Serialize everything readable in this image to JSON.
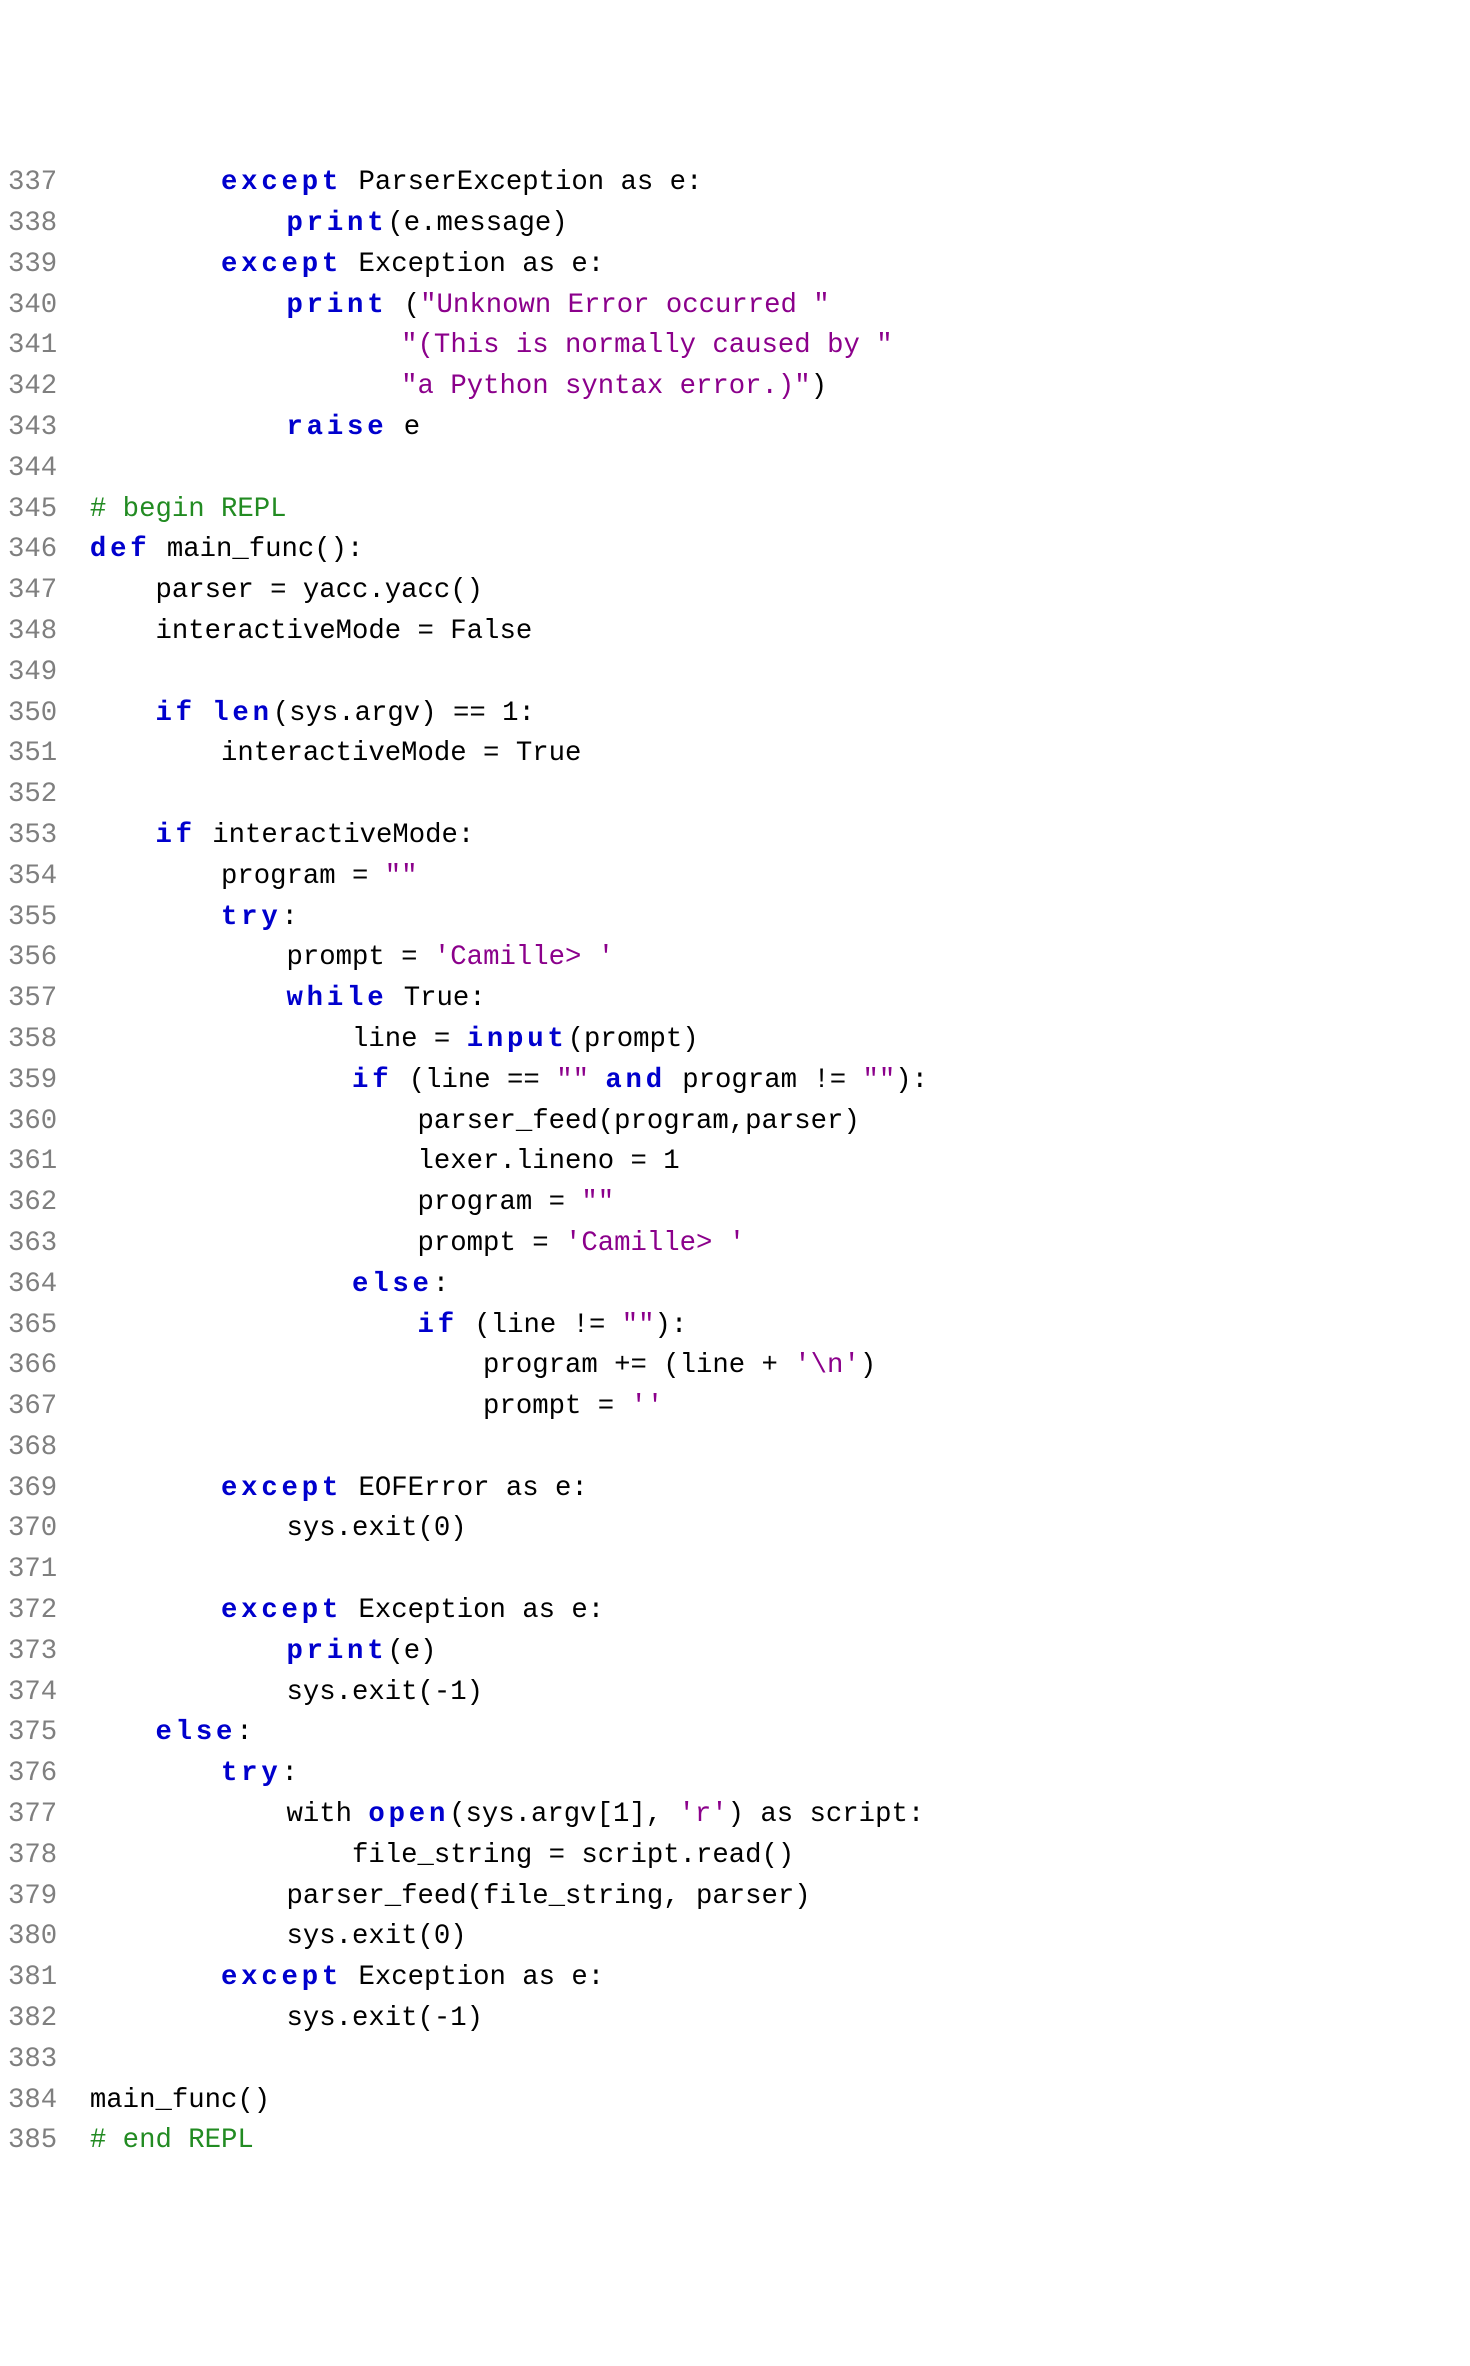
{
  "lines": [
    {
      "num": "337",
      "segments": [
        {
          "cls": "code",
          "t": "        "
        },
        {
          "cls": "kw",
          "t": "except"
        },
        {
          "cls": "code",
          "t": " ParserException as e:"
        }
      ]
    },
    {
      "num": "338",
      "segments": [
        {
          "cls": "code",
          "t": "            "
        },
        {
          "cls": "kw",
          "t": "print"
        },
        {
          "cls": "code",
          "t": "(e.message)"
        }
      ]
    },
    {
      "num": "339",
      "segments": [
        {
          "cls": "code",
          "t": "        "
        },
        {
          "cls": "kw",
          "t": "except"
        },
        {
          "cls": "code",
          "t": " Exception as e:"
        }
      ]
    },
    {
      "num": "340",
      "segments": [
        {
          "cls": "code",
          "t": "            "
        },
        {
          "cls": "kw",
          "t": "print"
        },
        {
          "cls": "code",
          "t": " ("
        },
        {
          "cls": "st",
          "t": "\"Unknown Error occurred \""
        }
      ]
    },
    {
      "num": "341",
      "segments": [
        {
          "cls": "code",
          "t": "                   "
        },
        {
          "cls": "st",
          "t": "\"(This is normally caused by \""
        }
      ]
    },
    {
      "num": "342",
      "segments": [
        {
          "cls": "code",
          "t": "                   "
        },
        {
          "cls": "st",
          "t": "\"a Python syntax error.)\""
        },
        {
          "cls": "code",
          "t": ")"
        }
      ]
    },
    {
      "num": "343",
      "segments": [
        {
          "cls": "code",
          "t": "            "
        },
        {
          "cls": "kw",
          "t": "raise"
        },
        {
          "cls": "code",
          "t": " e"
        }
      ]
    },
    {
      "num": "344",
      "segments": [
        {
          "cls": "code",
          "t": ""
        }
      ]
    },
    {
      "num": "345",
      "segments": [
        {
          "cls": "cm",
          "t": "# begin REPL"
        }
      ]
    },
    {
      "num": "346",
      "segments": [
        {
          "cls": "kw",
          "t": "def"
        },
        {
          "cls": "code",
          "t": " main_func():"
        }
      ]
    },
    {
      "num": "347",
      "segments": [
        {
          "cls": "code",
          "t": "    parser = yacc.yacc()"
        }
      ]
    },
    {
      "num": "348",
      "segments": [
        {
          "cls": "code",
          "t": "    interactiveMode = False"
        }
      ]
    },
    {
      "num": "349",
      "segments": [
        {
          "cls": "code",
          "t": ""
        }
      ]
    },
    {
      "num": "350",
      "segments": [
        {
          "cls": "code",
          "t": "    "
        },
        {
          "cls": "kw",
          "t": "if"
        },
        {
          "cls": "code",
          "t": " "
        },
        {
          "cls": "kw",
          "t": "len"
        },
        {
          "cls": "code",
          "t": "(sys.argv) == 1:"
        }
      ]
    },
    {
      "num": "351",
      "segments": [
        {
          "cls": "code",
          "t": "        interactiveMode = True"
        }
      ]
    },
    {
      "num": "352",
      "segments": [
        {
          "cls": "code",
          "t": ""
        }
      ]
    },
    {
      "num": "353",
      "segments": [
        {
          "cls": "code",
          "t": "    "
        },
        {
          "cls": "kw",
          "t": "if"
        },
        {
          "cls": "code",
          "t": " interactiveMode:"
        }
      ]
    },
    {
      "num": "354",
      "segments": [
        {
          "cls": "code",
          "t": "        program = "
        },
        {
          "cls": "st",
          "t": "\"\""
        }
      ]
    },
    {
      "num": "355",
      "segments": [
        {
          "cls": "code",
          "t": "        "
        },
        {
          "cls": "kw",
          "t": "try"
        },
        {
          "cls": "code",
          "t": ":"
        }
      ]
    },
    {
      "num": "356",
      "segments": [
        {
          "cls": "code",
          "t": "            prompt = "
        },
        {
          "cls": "st",
          "t": "'Camille> '"
        }
      ]
    },
    {
      "num": "357",
      "segments": [
        {
          "cls": "code",
          "t": "            "
        },
        {
          "cls": "kw",
          "t": "while"
        },
        {
          "cls": "code",
          "t": " True:"
        }
      ]
    },
    {
      "num": "358",
      "segments": [
        {
          "cls": "code",
          "t": "                line = "
        },
        {
          "cls": "kw",
          "t": "input"
        },
        {
          "cls": "code",
          "t": "(prompt)"
        }
      ]
    },
    {
      "num": "359",
      "segments": [
        {
          "cls": "code",
          "t": "                "
        },
        {
          "cls": "kw",
          "t": "if"
        },
        {
          "cls": "code",
          "t": " (line == "
        },
        {
          "cls": "st",
          "t": "\"\""
        },
        {
          "cls": "code",
          "t": " "
        },
        {
          "cls": "kw",
          "t": "and"
        },
        {
          "cls": "code",
          "t": " program != "
        },
        {
          "cls": "st",
          "t": "\"\""
        },
        {
          "cls": "code",
          "t": "):"
        }
      ]
    },
    {
      "num": "360",
      "segments": [
        {
          "cls": "code",
          "t": "                    parser_feed(program,parser)"
        }
      ]
    },
    {
      "num": "361",
      "segments": [
        {
          "cls": "code",
          "t": "                    lexer.lineno = 1"
        }
      ]
    },
    {
      "num": "362",
      "segments": [
        {
          "cls": "code",
          "t": "                    program = "
        },
        {
          "cls": "st",
          "t": "\"\""
        }
      ]
    },
    {
      "num": "363",
      "segments": [
        {
          "cls": "code",
          "t": "                    prompt = "
        },
        {
          "cls": "st",
          "t": "'Camille> '"
        }
      ]
    },
    {
      "num": "364",
      "segments": [
        {
          "cls": "code",
          "t": "                "
        },
        {
          "cls": "kw",
          "t": "else"
        },
        {
          "cls": "code",
          "t": ":"
        }
      ]
    },
    {
      "num": "365",
      "segments": [
        {
          "cls": "code",
          "t": "                    "
        },
        {
          "cls": "kw",
          "t": "if"
        },
        {
          "cls": "code",
          "t": " (line != "
        },
        {
          "cls": "st",
          "t": "\"\""
        },
        {
          "cls": "code",
          "t": "):"
        }
      ]
    },
    {
      "num": "366",
      "segments": [
        {
          "cls": "code",
          "t": "                        program += (line + "
        },
        {
          "cls": "st",
          "t": "'\\n'"
        },
        {
          "cls": "code",
          "t": ")"
        }
      ]
    },
    {
      "num": "367",
      "segments": [
        {
          "cls": "code",
          "t": "                        prompt = "
        },
        {
          "cls": "st",
          "t": "''"
        }
      ]
    },
    {
      "num": "368",
      "segments": [
        {
          "cls": "code",
          "t": ""
        }
      ]
    },
    {
      "num": "369",
      "segments": [
        {
          "cls": "code",
          "t": "        "
        },
        {
          "cls": "kw",
          "t": "except"
        },
        {
          "cls": "code",
          "t": " EOFError as e:"
        }
      ]
    },
    {
      "num": "370",
      "segments": [
        {
          "cls": "code",
          "t": "            sys.exit(0)"
        }
      ]
    },
    {
      "num": "371",
      "segments": [
        {
          "cls": "code",
          "t": ""
        }
      ]
    },
    {
      "num": "372",
      "segments": [
        {
          "cls": "code",
          "t": "        "
        },
        {
          "cls": "kw",
          "t": "except"
        },
        {
          "cls": "code",
          "t": " Exception as e:"
        }
      ]
    },
    {
      "num": "373",
      "segments": [
        {
          "cls": "code",
          "t": "            "
        },
        {
          "cls": "kw",
          "t": "print"
        },
        {
          "cls": "code",
          "t": "(e)"
        }
      ]
    },
    {
      "num": "374",
      "segments": [
        {
          "cls": "code",
          "t": "            sys.exit(-1)"
        }
      ]
    },
    {
      "num": "375",
      "segments": [
        {
          "cls": "code",
          "t": "    "
        },
        {
          "cls": "kw",
          "t": "else"
        },
        {
          "cls": "code",
          "t": ":"
        }
      ]
    },
    {
      "num": "376",
      "segments": [
        {
          "cls": "code",
          "t": "        "
        },
        {
          "cls": "kw",
          "t": "try"
        },
        {
          "cls": "code",
          "t": ":"
        }
      ]
    },
    {
      "num": "377",
      "segments": [
        {
          "cls": "code",
          "t": "            with "
        },
        {
          "cls": "kw",
          "t": "open"
        },
        {
          "cls": "code",
          "t": "(sys.argv[1], "
        },
        {
          "cls": "st",
          "t": "'r'"
        },
        {
          "cls": "code",
          "t": ") as script:"
        }
      ]
    },
    {
      "num": "378",
      "segments": [
        {
          "cls": "code",
          "t": "                file_string = script.read()"
        }
      ]
    },
    {
      "num": "379",
      "segments": [
        {
          "cls": "code",
          "t": "            parser_feed(file_string, parser)"
        }
      ]
    },
    {
      "num": "380",
      "segments": [
        {
          "cls": "code",
          "t": "            sys.exit(0)"
        }
      ]
    },
    {
      "num": "381",
      "segments": [
        {
          "cls": "code",
          "t": "        "
        },
        {
          "cls": "kw",
          "t": "except"
        },
        {
          "cls": "code",
          "t": " Exception as e:"
        }
      ]
    },
    {
      "num": "382",
      "segments": [
        {
          "cls": "code",
          "t": "            sys.exit(-1)"
        }
      ]
    },
    {
      "num": "383",
      "segments": [
        {
          "cls": "code",
          "t": ""
        }
      ]
    },
    {
      "num": "384",
      "segments": [
        {
          "cls": "code",
          "t": "main_func()"
        }
      ]
    },
    {
      "num": "385",
      "segments": [
        {
          "cls": "cm",
          "t": "# end REPL"
        }
      ]
    }
  ]
}
